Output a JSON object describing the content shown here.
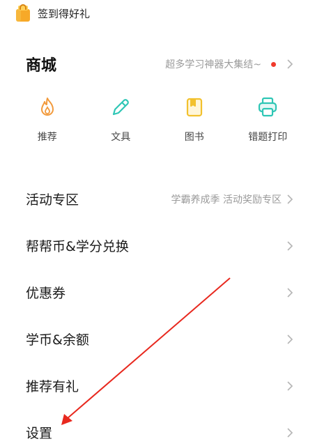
{
  "signin": {
    "label": "签到得好礼",
    "icon": "shopping-bag-icon"
  },
  "mall": {
    "title": "商城",
    "promo": "超多学习神器大集结~",
    "categories": [
      {
        "label": "推荐",
        "icon": "flame-icon",
        "color": "#f29a3c"
      },
      {
        "label": "文具",
        "icon": "pencil-icon",
        "color": "#2ec6b5"
      },
      {
        "label": "图书",
        "icon": "book-icon",
        "color": "#f2c12e"
      },
      {
        "label": "错题打印",
        "icon": "printer-icon",
        "color": "#2ec6b5"
      }
    ]
  },
  "menu": [
    {
      "label": "活动专区",
      "extra": "学霸养成季 活动奖励专区"
    },
    {
      "label": "帮帮币&学分兑换",
      "extra": ""
    },
    {
      "label": "优惠券",
      "extra": ""
    },
    {
      "label": "学币&余额",
      "extra": ""
    },
    {
      "label": "推荐有礼",
      "extra": ""
    },
    {
      "label": "设置",
      "extra": ""
    }
  ],
  "colors": {
    "accent_red": "#f03a2c",
    "annotation_arrow": "#e8281e",
    "chevron": "#b5b5b5"
  }
}
